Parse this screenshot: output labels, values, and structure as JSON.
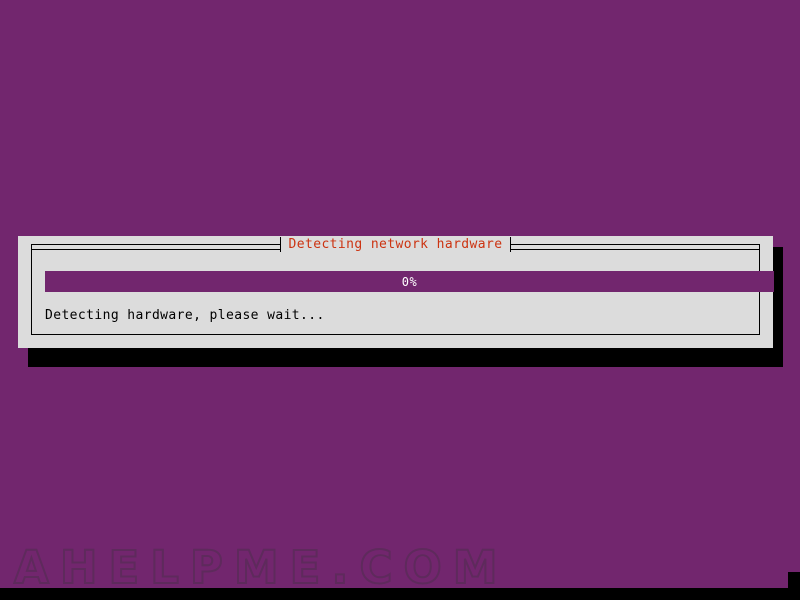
{
  "screen": {
    "background_color": "#72266e",
    "bottom_bar_color": "#000000",
    "cursor": {
      "name": "terminal-cursor",
      "color": "#000000"
    }
  },
  "watermark": {
    "text": "AHELPME.COM",
    "color": "#5e2a5c"
  },
  "dialog": {
    "title": "Detecting network hardware",
    "title_color": "#cc3311",
    "panel_color": "#dcdcdc",
    "border_color": "#000000",
    "shadow_color": "#000000",
    "progress": {
      "label": "0%",
      "percent": 0,
      "fill_color": "#72266e",
      "label_color": "#ffffff"
    },
    "status_message": "Detecting hardware, please wait...",
    "status_color": "#000000"
  }
}
